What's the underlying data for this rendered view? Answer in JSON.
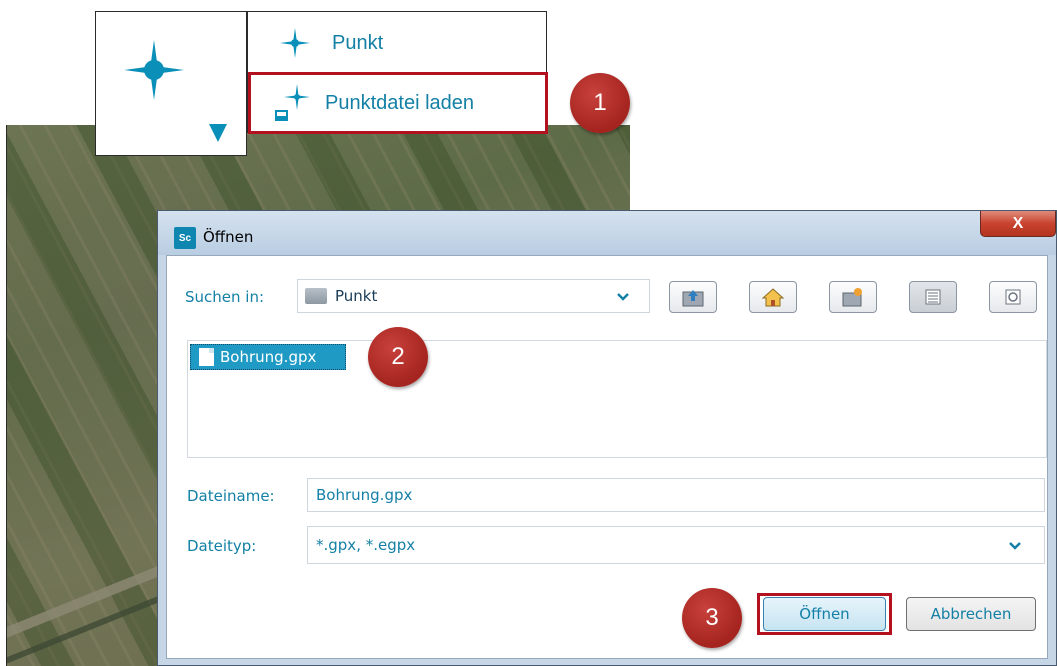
{
  "menu": {
    "items": [
      {
        "label": "Punkt"
      },
      {
        "label": "Punktdatei laden"
      }
    ]
  },
  "badges": [
    "1",
    "2",
    "3"
  ],
  "dialog": {
    "title": "Öffnen",
    "app_icon": "Sc",
    "close_label": "X",
    "look_in": {
      "label": "Suchen in:",
      "value": "Punkt"
    },
    "toolbar_icons": [
      "up-folder-icon",
      "home-icon",
      "new-folder-icon",
      "list-view-icon",
      "details-view-icon"
    ],
    "files": [
      {
        "name": "Bohrung.gpx"
      }
    ],
    "filename": {
      "label": "Dateiname:",
      "value": "Bohrung.gpx"
    },
    "filetype": {
      "label": "Dateityp:",
      "value": "*.gpx, *.egpx"
    },
    "buttons": {
      "open": "Öffnen",
      "cancel": "Abbrechen"
    }
  },
  "colors": {
    "accent": "#1480a6",
    "highlight": "#b31020",
    "selection": "#1f9ac4"
  }
}
